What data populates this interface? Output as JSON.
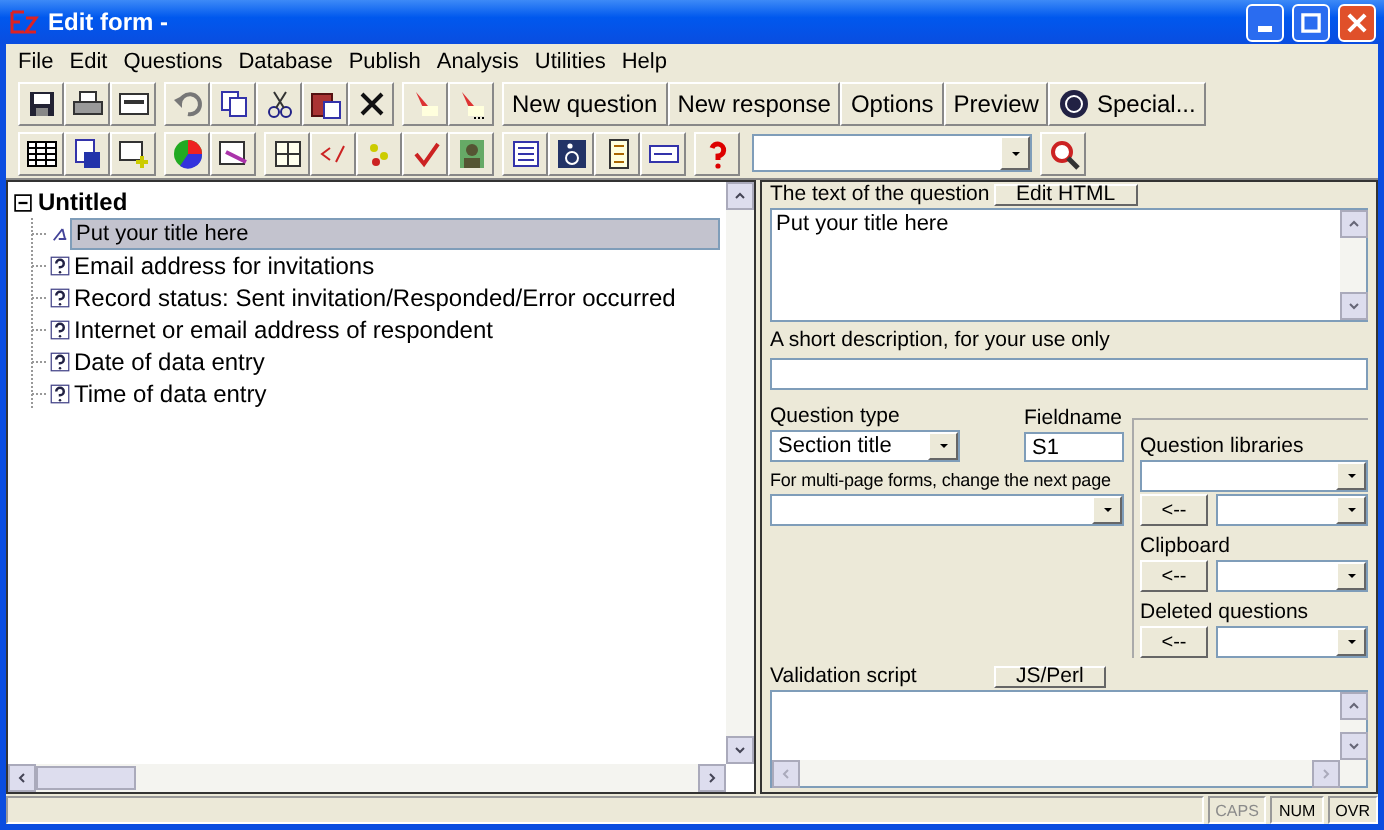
{
  "window": {
    "title": "Edit form -"
  },
  "menu": [
    {
      "label": "File"
    },
    {
      "label": "Edit"
    },
    {
      "label": "Questions"
    },
    {
      "label": "Database"
    },
    {
      "label": "Publish"
    },
    {
      "label": "Analysis"
    },
    {
      "label": "Utilities"
    },
    {
      "label": "Help"
    }
  ],
  "toolbar": {
    "buttons": [
      {
        "label": "New question"
      },
      {
        "label": "New response"
      },
      {
        "label": "Options"
      },
      {
        "label": "Preview"
      },
      {
        "label": "Special..."
      }
    ]
  },
  "tree": {
    "root": {
      "label": "Untitled",
      "expanded": true,
      "children": [
        {
          "label": "Put your title here",
          "kind": "title",
          "selected": true
        },
        {
          "label": "Email address for invitations",
          "kind": "question",
          "selected": false
        },
        {
          "label": "Record status: Sent invitation/Responded/Error occurred",
          "kind": "question",
          "selected": false
        },
        {
          "label": "Internet or email address of respondent",
          "kind": "question",
          "selected": false
        },
        {
          "label": "Date of data entry",
          "kind": "question",
          "selected": false
        },
        {
          "label": "Time of data entry",
          "kind": "question",
          "selected": false
        }
      ]
    }
  },
  "editor": {
    "question_text": {
      "label": "The text of the question",
      "button": "Edit HTML",
      "value": "Put your title here"
    },
    "description": {
      "label": "A short description, for your use only"
    },
    "question_type": {
      "label": "Question type",
      "value": "Section title"
    },
    "fieldname": {
      "label": "Fieldname",
      "value": "S1"
    },
    "next_page": {
      "label": "For multi-page forms, change the next page"
    },
    "sources": [
      {
        "kind": "label",
        "text": "Question libraries"
      },
      {
        "kind": "select"
      },
      {
        "kind": "transfer",
        "text": "<--"
      },
      {
        "kind": "label",
        "text": "Clipboard"
      },
      {
        "kind": "transfer",
        "text": "<--"
      },
      {
        "kind": "label",
        "text": "Deleted questions"
      },
      {
        "kind": "transfer",
        "text": "<--"
      }
    ],
    "validation": {
      "label": "Validation script",
      "button": "JS/Perl"
    }
  },
  "status_bar": [
    {
      "label": "CAPS",
      "disabled": true
    },
    {
      "label": "NUM",
      "disabled": false
    },
    {
      "label": "OVR",
      "disabled": false
    }
  ]
}
